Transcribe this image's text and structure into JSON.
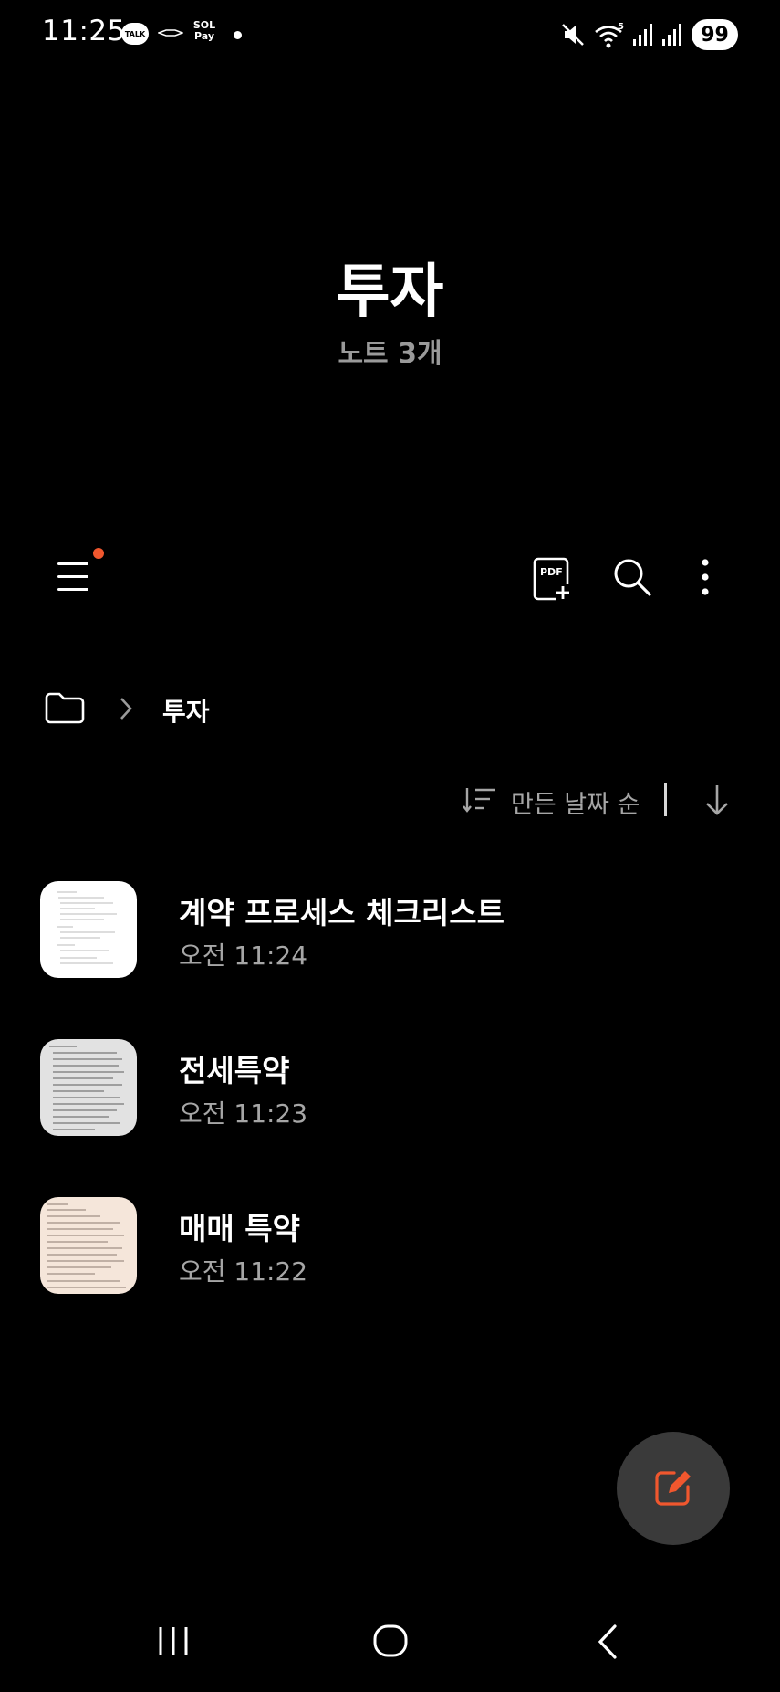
{
  "status_bar": {
    "time": "11:25",
    "talk_label": "TALK",
    "sol_label_line1": "SOL",
    "sol_label_line2": "Pay",
    "battery": "99",
    "icons": [
      "kakaotalk-icon",
      "brand-icon",
      "sol-pay-icon",
      "notification-dot-icon",
      "mute-icon",
      "wifi-5g-icon",
      "signal-icon",
      "signal-icon",
      "battery-icon"
    ]
  },
  "header": {
    "title": "투자",
    "subtitle": "노트 3개"
  },
  "toolbar": {
    "icons": [
      "menu-icon",
      "pdf-add-icon",
      "search-icon",
      "more-icon"
    ],
    "pdf_label": "PDF",
    "notification_color": "#f0572e"
  },
  "breadcrumb": {
    "current": "투자"
  },
  "sort": {
    "label": "만든 날짜 순"
  },
  "notes": [
    {
      "title": "계약 프로세스 체크리스트",
      "time": "오전 11:24",
      "thumb_bg": "#ffffff"
    },
    {
      "title": "전세특약",
      "time": "오전 11:23",
      "thumb_bg": "#e2e2e2"
    },
    {
      "title": "매매 특약",
      "time": "오전 11:22",
      "thumb_bg": "#f5e6da"
    }
  ],
  "fab": {
    "icon": "new-note-icon",
    "accent_color": "#f0572e"
  },
  "nav_bar": {
    "icons": [
      "recent-apps-icon",
      "home-icon",
      "back-icon"
    ]
  }
}
